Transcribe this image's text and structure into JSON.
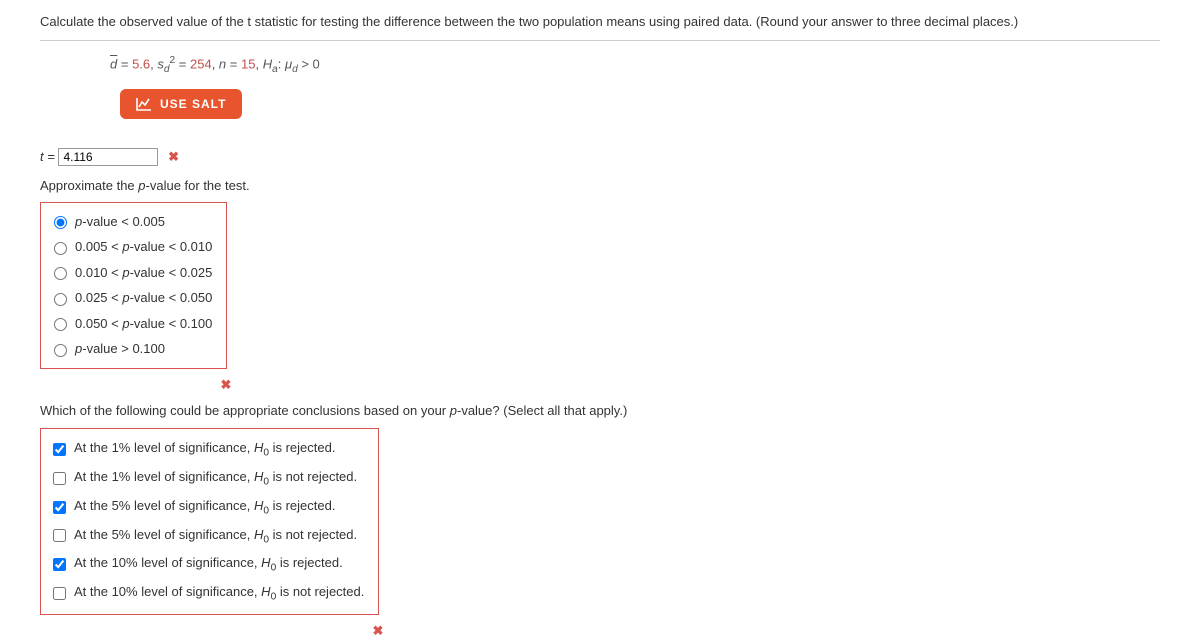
{
  "question": {
    "prompt": "Calculate the observed value of the t statistic for testing the difference between the two population means using paired data. (Round your answer to three decimal places.)",
    "given": {
      "d_bar_label": "d",
      "d_bar_value": "5.6",
      "s_label": "s",
      "s_sub": "d",
      "s_sup": "2",
      "s_value": "254",
      "n_label": "n",
      "n_value": "15",
      "hyp_prefix": "H",
      "hyp_sub_a": "a",
      "mu": "μ",
      "mu_sub": "d",
      "gt0": "> 0"
    },
    "salt_label": "USE SALT",
    "t_label": "t =",
    "t_value": "4.116",
    "approx_label": "Approximate the p-value for the test.",
    "p_options": [
      "p-value < 0.005",
      "0.005 < p-value < 0.010",
      "0.010 < p-value < 0.025",
      "0.025 < p-value < 0.050",
      "0.050 < p-value < 0.100",
      "p-value > 0.100"
    ],
    "p_selected_index": 0,
    "concl_label": "Which of the following could be appropriate conclusions based on your p-value? (Select all that apply.)",
    "concl_options": [
      {
        "pre": "At the 1% level of significance, ",
        "post": " is rejected.",
        "checked": true
      },
      {
        "pre": "At the 1% level of significance, ",
        "post": " is not rejected.",
        "checked": false
      },
      {
        "pre": "At the 5% level of significance, ",
        "post": " is rejected.",
        "checked": true
      },
      {
        "pre": "At the 5% level of significance, ",
        "post": " is not rejected.",
        "checked": false
      },
      {
        "pre": "At the 10% level of significance, ",
        "post": " is rejected.",
        "checked": true
      },
      {
        "pre": "At the 10% level of significance, ",
        "post": " is not rejected.",
        "checked": false
      }
    ]
  }
}
